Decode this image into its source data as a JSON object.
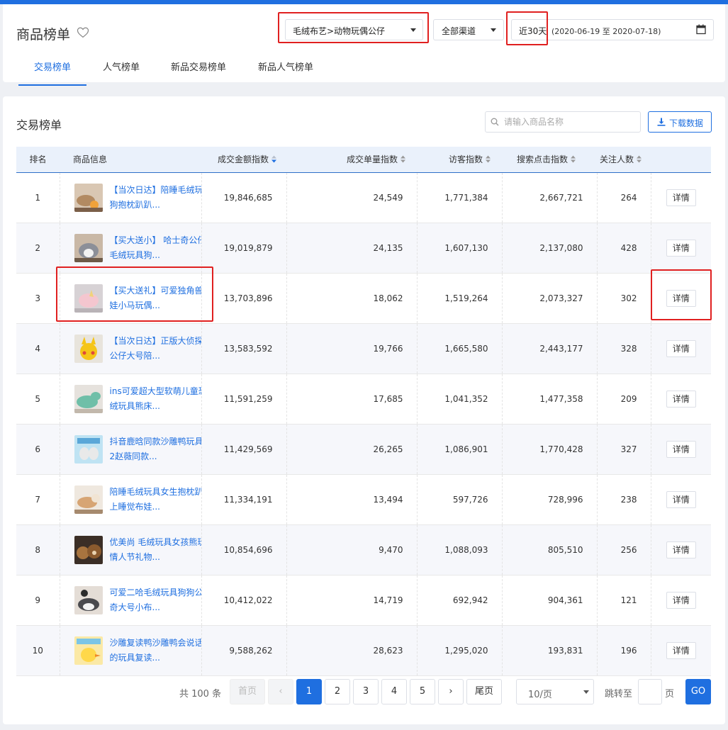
{
  "header": {
    "title": "商品榜单",
    "category": "毛绒布艺>动物玩偶公仔",
    "channel": "全部渠道",
    "range": "近30天",
    "dates": "(2020-06-19 至 2020-07-18)",
    "tabs": [
      "交易榜单",
      "人气榜单",
      "新品交易榜单",
      "新品人气榜单"
    ],
    "active_tab": "交易榜单"
  },
  "section": {
    "title": "交易榜单",
    "search_placeholder": "请输入商品名称",
    "download_label": "下载数据"
  },
  "table": {
    "columns": [
      "排名",
      "商品信息",
      "成交金额指数",
      "成交单量指数",
      "访客指数",
      "搜索点击指数",
      "关注人数",
      ""
    ],
    "sorted_column": "成交金额指数",
    "detail_label": "详情",
    "rows": [
      {
        "rank": "1",
        "name1": "【当次日达】陪睡毛绒玩",
        "name2": "狗抱枕趴趴...",
        "amount": "19,846,685",
        "orders": "24,549",
        "visitors": "1,771,384",
        "search": "2,667,721",
        "followers": "264"
      },
      {
        "rank": "2",
        "name1": "【买大送小】 哈士奇公仔",
        "name2": "毛绒玩具狗...",
        "amount": "19,019,879",
        "orders": "24,135",
        "visitors": "1,607,130",
        "search": "2,137,080",
        "followers": "428"
      },
      {
        "rank": "3",
        "name1": "【买大送礼】可爱独角兽",
        "name2": "娃小马玩偶...",
        "amount": "13,703,896",
        "orders": "18,062",
        "visitors": "1,519,264",
        "search": "2,073,327",
        "followers": "302"
      },
      {
        "rank": "4",
        "name1": "【当次日达】正版大侦探",
        "name2": "公仔大号陪...",
        "amount": "13,583,592",
        "orders": "19,766",
        "visitors": "1,665,580",
        "search": "2,443,177",
        "followers": "328"
      },
      {
        "rank": "5",
        "name1": "ins可爱超大型软萌儿童恐",
        "name2": "绒玩具熊床...",
        "amount": "11,591,259",
        "orders": "17,685",
        "visitors": "1,041,352",
        "search": "1,477,358",
        "followers": "209"
      },
      {
        "rank": "6",
        "name1": "抖音鹿晗同款沙雕鸭玩具",
        "name2": "2赵薇同款...",
        "amount": "11,429,569",
        "orders": "26,265",
        "visitors": "1,086,901",
        "search": "1,770,428",
        "followers": "327"
      },
      {
        "rank": "7",
        "name1": "陪睡毛绒玩具女生抱枕趴",
        "name2": "上睡觉布娃...",
        "amount": "11,334,191",
        "orders": "13,494",
        "visitors": "597,726",
        "search": "728,996",
        "followers": "238"
      },
      {
        "rank": "8",
        "name1": "优美尚 毛绒玩具女孩熊玩",
        "name2": "情人节礼物...",
        "amount": "10,854,696",
        "orders": "9,470",
        "visitors": "1,088,093",
        "search": "805,510",
        "followers": "256"
      },
      {
        "rank": "9",
        "name1": "可爱二哈毛绒玩具狗狗公",
        "name2": "奇大号小布...",
        "amount": "10,412,022",
        "orders": "14,719",
        "visitors": "692,942",
        "search": "904,361",
        "followers": "121"
      },
      {
        "rank": "10",
        "name1": "沙雕复读鸭沙雕鸭会说话",
        "name2": "的玩具复读...",
        "amount": "9,588,262",
        "orders": "28,623",
        "visitors": "1,295,020",
        "search": "193,831",
        "followers": "196"
      }
    ]
  },
  "pagination": {
    "total": "共 100 条",
    "first": "首页",
    "prev": "‹",
    "pages": [
      "1",
      "2",
      "3",
      "4",
      "5"
    ],
    "current": "1",
    "next": "›",
    "last": "尾页",
    "page_size": "10/页",
    "jump_label": "跳转至",
    "page_label": "页",
    "go": "GO"
  },
  "colors": {
    "accent": "#1f6fe0",
    "highlight": "#e02020"
  }
}
